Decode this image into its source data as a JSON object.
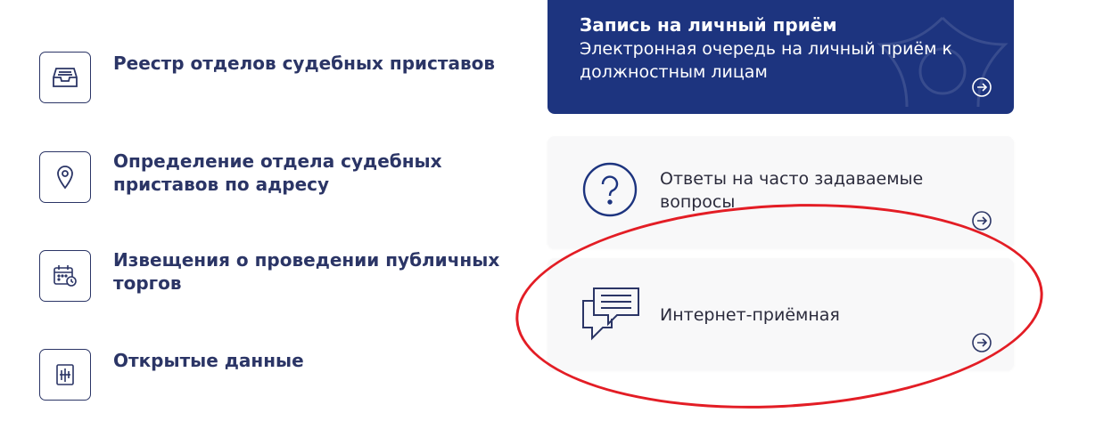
{
  "left_menu": [
    {
      "label": "Реестр отделов судебных приставов",
      "icon": "inbox-tray-icon"
    },
    {
      "label": "Определение отдела судебных приставов по адресу",
      "icon": "location-pin-icon"
    },
    {
      "label": "Извещения о проведении публичных торгов",
      "icon": "calendar-clock-icon"
    },
    {
      "label": "Открытые данные",
      "icon": "data-file-icon"
    }
  ],
  "cards": {
    "appointment": {
      "title": "Запись на личный приём",
      "description": "Электронная очередь на личный приём к должностным лицам"
    },
    "faq": {
      "label": "Ответы на часто задаваемые вопросы",
      "icon": "question-circle-icon"
    },
    "reception": {
      "label": "Интернет-приёмная",
      "icon": "chat-bubbles-icon"
    }
  },
  "colors": {
    "primary": "#1d347f",
    "text_dark": "#2b3566",
    "annotation": "#e31d25",
    "card_light": "#f8f8f9"
  }
}
